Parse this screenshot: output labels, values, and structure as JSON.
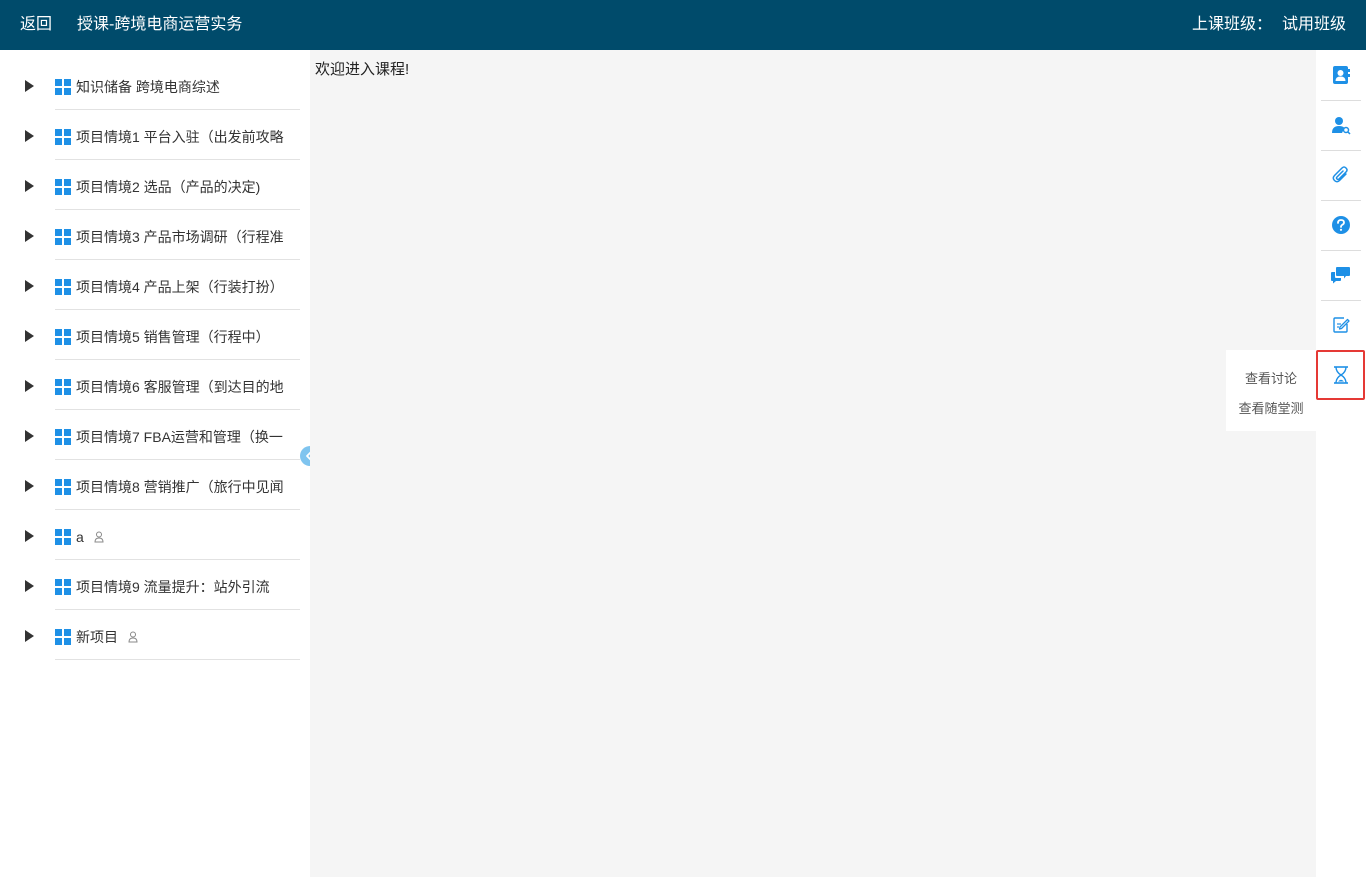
{
  "header": {
    "back_label": "返回",
    "title": "授课-跨境电商运营实务",
    "class_label": "上课班级：",
    "class_value": "试用班级"
  },
  "sidebar": {
    "items": [
      {
        "label": "知识储备 跨境电商综述",
        "person": false
      },
      {
        "label": "项目情境1 平台入驻（出发前攻略",
        "person": false
      },
      {
        "label": "项目情境2 选品（产品的决定)",
        "person": false
      },
      {
        "label": "项目情境3 产品市场调研（行程准",
        "person": false
      },
      {
        "label": "项目情境4 产品上架（行装打扮）",
        "person": false
      },
      {
        "label": "项目情境5 销售管理（行程中）",
        "person": false
      },
      {
        "label": "项目情境6 客服管理（到达目的地",
        "person": false
      },
      {
        "label": "项目情境7 FBA运营和管理（换一",
        "person": false
      },
      {
        "label": "项目情境8 营销推广（旅行中见闻",
        "person": false
      },
      {
        "label": "a",
        "person": true
      },
      {
        "label": "项目情境9 流量提升：站外引流",
        "person": false
      },
      {
        "label": "新项目",
        "person": true
      }
    ]
  },
  "main": {
    "welcome_text": "欢迎进入课程!"
  },
  "toolbar": {
    "tools": [
      "contacts-icon",
      "user-search-icon",
      "paperclip-icon",
      "help-icon",
      "chat-icon",
      "edit-icon",
      "hourglass-icon"
    ],
    "accent_color": "#1e90e6",
    "active_border_color": "#e53935"
  },
  "popup": {
    "view_discussion": "查看讨论",
    "view_quiz": "查看随堂测"
  },
  "colors": {
    "header_bg": "#004b6b",
    "icon_blue": "#1e90e6"
  }
}
